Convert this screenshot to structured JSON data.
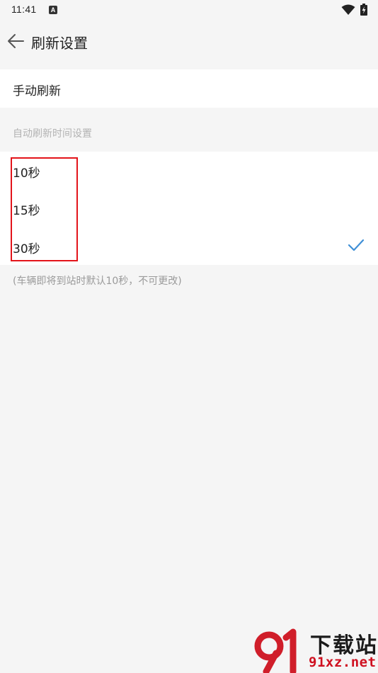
{
  "status_bar": {
    "time": "11:41",
    "app_icon_letter": "A"
  },
  "header": {
    "title": "刷新设置"
  },
  "manual_refresh": {
    "label": "手动刷新"
  },
  "auto_refresh": {
    "section_title": "自动刷新时间设置",
    "options": [
      {
        "label": "10秒",
        "selected": false
      },
      {
        "label": "15秒",
        "selected": false
      },
      {
        "label": "30秒",
        "selected": true
      }
    ],
    "note": "(车辆即将到站时默认10秒，不可更改)"
  },
  "watermark": {
    "title": "下载站",
    "url": "91xz.net"
  },
  "colors": {
    "accent": "#3f8fd6",
    "highlight": "#e3141a",
    "background": "#f5f5f5"
  },
  "icons": {
    "back": "arrow-left-icon",
    "check": "checkmark-icon",
    "wifi": "wifi-icon",
    "battery": "battery-charging-icon"
  }
}
